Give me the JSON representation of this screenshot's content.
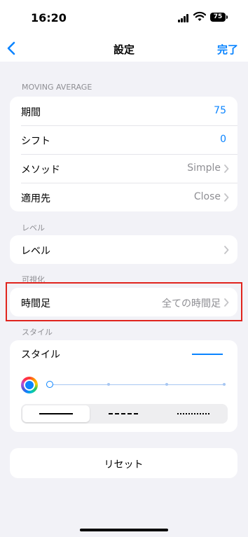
{
  "status": {
    "time": "16:20",
    "battery": "75"
  },
  "nav": {
    "title": "設定",
    "done": "完了"
  },
  "sections": {
    "moving_average": "MOVING AVERAGE",
    "level": "レベル",
    "visualization": "可視化",
    "style": "スタイル"
  },
  "ma_rows": [
    {
      "label": "期間",
      "value": "75"
    },
    {
      "label": "シフト",
      "value": "0"
    },
    {
      "label": "メソッド",
      "value": "Simple"
    },
    {
      "label": "適用先",
      "value": "Close"
    }
  ],
  "level_row": {
    "label": "レベル"
  },
  "timeframe_row": {
    "label": "時間足",
    "value": "全ての時間足"
  },
  "style_card": {
    "label": "スタイル",
    "line_color": "#0a84ff",
    "thickness_level": 0.0,
    "line_styles": [
      "solid",
      "dashed",
      "dotted"
    ],
    "selected_line_style": "solid"
  },
  "reset": {
    "label": "リセット"
  },
  "colors": {
    "accent": "#0a84ff",
    "highlight": "#e0241e"
  }
}
